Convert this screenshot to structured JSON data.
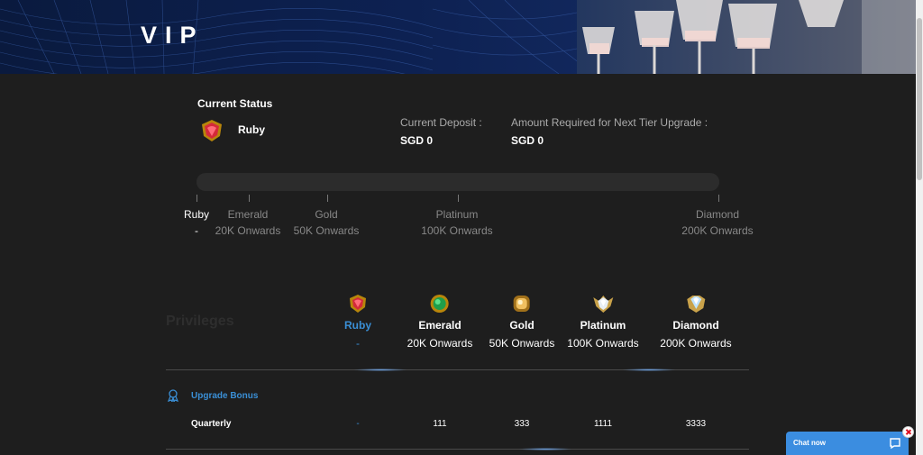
{
  "header": {
    "title": "VIP"
  },
  "status": {
    "title": "Current Status",
    "tier": "Ruby",
    "current_deposit_label": "Current Deposit :",
    "current_deposit_value": "SGD 0",
    "required_label": "Amount Required for Next Tier Upgrade :",
    "required_value": "SGD 0"
  },
  "progress": {
    "fill_fraction": 0,
    "tiers": [
      {
        "name": "Ruby",
        "amount": "-"
      },
      {
        "name": "Emerald",
        "amount": "20K Onwards"
      },
      {
        "name": "Gold",
        "amount": "50K Onwards"
      },
      {
        "name": "Platinum",
        "amount": "100K Onwards"
      },
      {
        "name": "Diamond",
        "amount": "200K Onwards"
      }
    ]
  },
  "privileges": {
    "label": "Privileges",
    "columns": [
      {
        "name": "Ruby",
        "amount": "-",
        "icon": "ruby-badge-icon"
      },
      {
        "name": "Emerald",
        "amount": "20K Onwards",
        "icon": "emerald-badge-icon"
      },
      {
        "name": "Gold",
        "amount": "50K Onwards",
        "icon": "gold-badge-icon"
      },
      {
        "name": "Platinum",
        "amount": "100K Onwards",
        "icon": "platinum-badge-icon"
      },
      {
        "name": "Diamond",
        "amount": "200K Onwards",
        "icon": "diamond-badge-icon"
      }
    ],
    "sections": [
      {
        "title": "Upgrade Bonus",
        "icon": "ribbon-icon",
        "rows": [
          {
            "label": "Quarterly",
            "values": [
              "-",
              "111",
              "333",
              "1111",
              "3333"
            ]
          }
        ]
      }
    ]
  },
  "chat": {
    "label": "Chat now",
    "icon": "chat-bubble-icon"
  },
  "colors": {
    "accent": "#3a8fd6",
    "background": "#1e1e1e",
    "chat": "#3b8de0"
  }
}
